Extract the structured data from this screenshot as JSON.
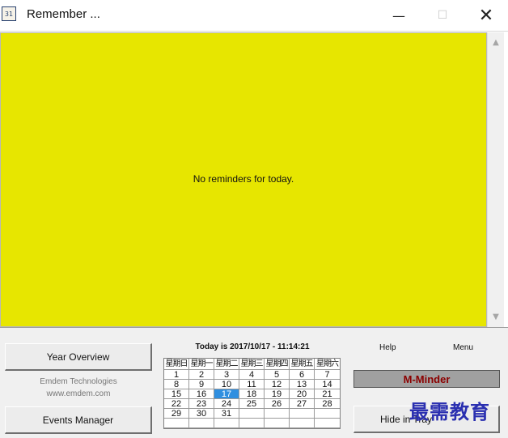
{
  "window": {
    "title": "Remember ...",
    "icon": "calendar-icon",
    "controls": {
      "minimize": "—",
      "maximize": "☐",
      "close": "✕"
    }
  },
  "content": {
    "message": "No reminders for today.",
    "background": "#e7e600"
  },
  "left_panel": {
    "year_overview_label": "Year Overview",
    "company_name": "Emdem Technologies",
    "company_url": "www.emdem.com",
    "events_manager_label": "Events Manager"
  },
  "calendar": {
    "today_text": "Today is 2017/10/17 - 11:14:21",
    "headers": [
      "星期日",
      "星期一",
      "星期二",
      "星期三",
      "星期四",
      "星期五",
      "星期六"
    ],
    "weeks": [
      [
        "1",
        "2",
        "3",
        "4",
        "5",
        "6",
        "7"
      ],
      [
        "8",
        "9",
        "10",
        "11",
        "12",
        "13",
        "14"
      ],
      [
        "15",
        "16",
        "17",
        "18",
        "19",
        "20",
        "21"
      ],
      [
        "22",
        "23",
        "24",
        "25",
        "26",
        "27",
        "28"
      ],
      [
        "29",
        "30",
        "31",
        "",
        "",
        "",
        ""
      ],
      [
        "",
        "",
        "",
        "",
        "",
        "",
        ""
      ]
    ],
    "today_day": "17",
    "highlight_color": "#2f8fe0"
  },
  "right_panel": {
    "help_label": "Help",
    "menu_label": "Menu",
    "product_label": "M-Minder",
    "hide_label": "Hide in Tray"
  },
  "watermark": "最需教育"
}
